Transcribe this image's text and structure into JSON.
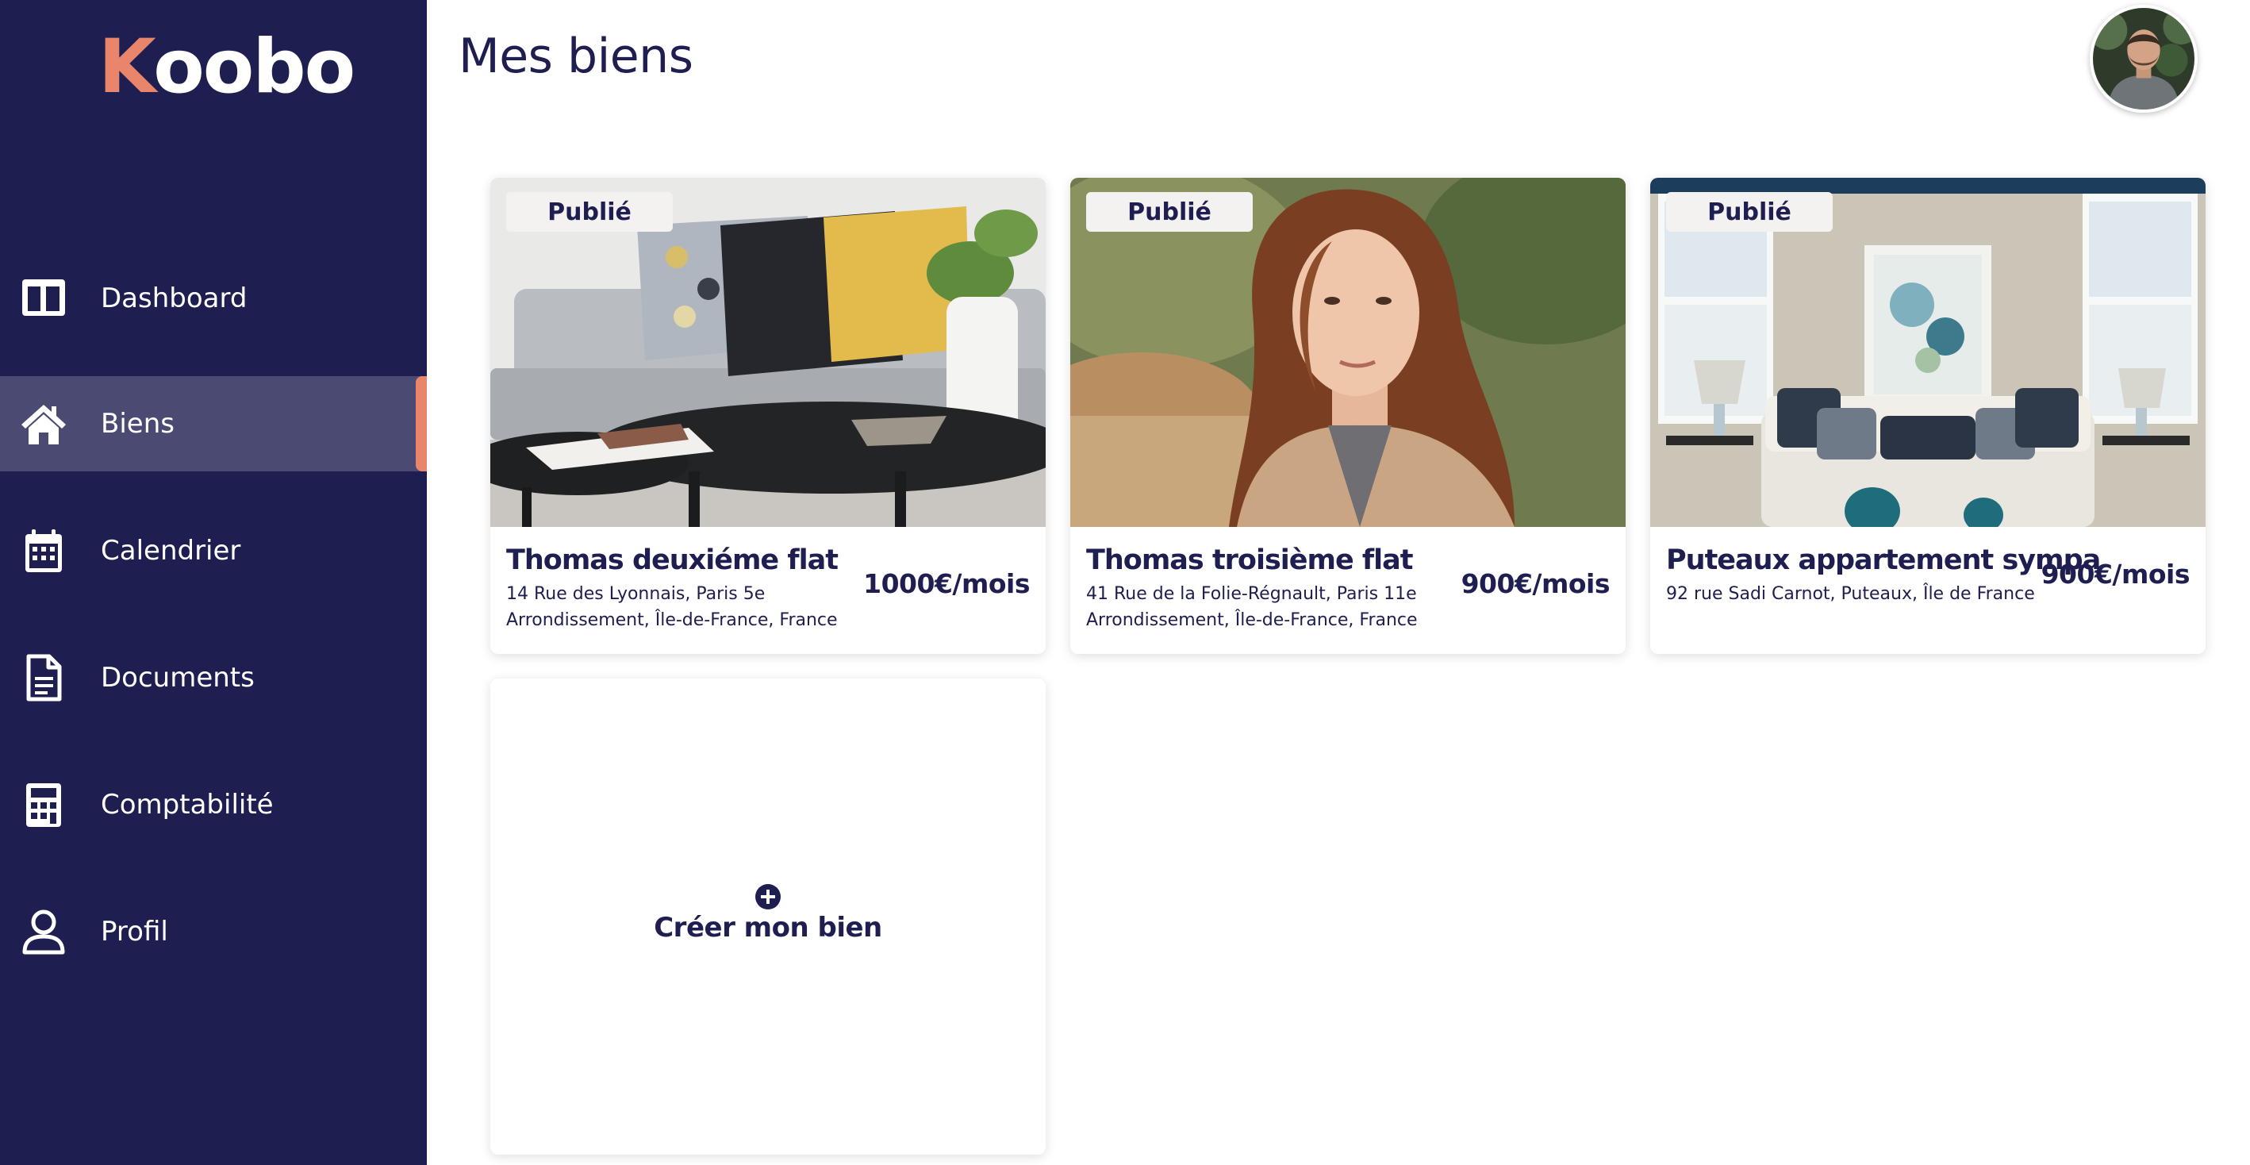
{
  "app": {
    "logo_first": "K",
    "logo_rest": "oobo"
  },
  "sidebar": {
    "items": [
      {
        "label": "Dashboard",
        "icon": "dashboard-icon"
      },
      {
        "label": "Biens",
        "icon": "home-icon",
        "active": true
      },
      {
        "label": "Calendrier",
        "icon": "calendar-icon"
      },
      {
        "label": "Documents",
        "icon": "document-icon"
      },
      {
        "label": "Comptabilité",
        "icon": "calculator-icon"
      },
      {
        "label": "Profil",
        "icon": "user-icon"
      }
    ]
  },
  "header": {
    "title": "Mes biens",
    "avatar": "user-avatar"
  },
  "properties": [
    {
      "status": "Publié",
      "title": "Thomas deuxiéme flat",
      "address": "14 Rue des Lyonnais, Paris 5e Arrondissement, Île-de-France, France",
      "price": "1000€/mois"
    },
    {
      "status": "Publié",
      "title": "Thomas troisième flat",
      "address": "41 Rue de la Folie-Régnault, Paris 11e Arrondissement, Île-de-France, France",
      "price": "900€/mois"
    },
    {
      "status": "Publié",
      "title": "Puteaux appartement sympa",
      "address": "92 rue Sadi Carnot, Puteaux, Île de France",
      "price": "900€/mois"
    }
  ],
  "create": {
    "label": "Créer mon bien",
    "icon": "plus-circle-icon"
  },
  "colors": {
    "sidebar_bg": "#1e1e50",
    "accent": "#e8856b",
    "active_item_bg": "#4a4a72",
    "text_dark": "#1e1e50"
  }
}
